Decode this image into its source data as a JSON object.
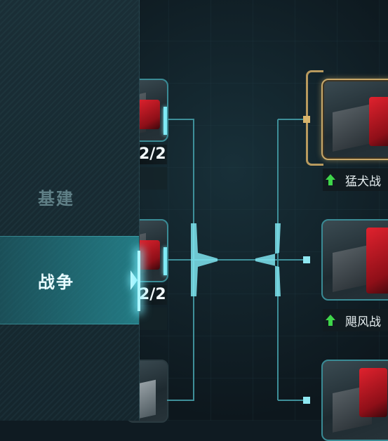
{
  "sidebar": {
    "tabs": [
      {
        "label": "基建",
        "active": false
      },
      {
        "label": "战争",
        "active": true
      }
    ]
  },
  "left_column": {
    "items": [
      {
        "count": "2/2"
      },
      {
        "count": "2/2"
      },
      {
        "count": ""
      }
    ]
  },
  "right_column": {
    "items": [
      {
        "name": "猛犬战",
        "selected": true,
        "arrow": "up"
      },
      {
        "name": "飓风战",
        "selected": false,
        "arrow": "up"
      },
      {
        "name": "",
        "selected": false
      }
    ]
  },
  "colors": {
    "accent": "#7fe9f5",
    "gold": "#c9a96a",
    "upgrade": "#3fd54a"
  }
}
